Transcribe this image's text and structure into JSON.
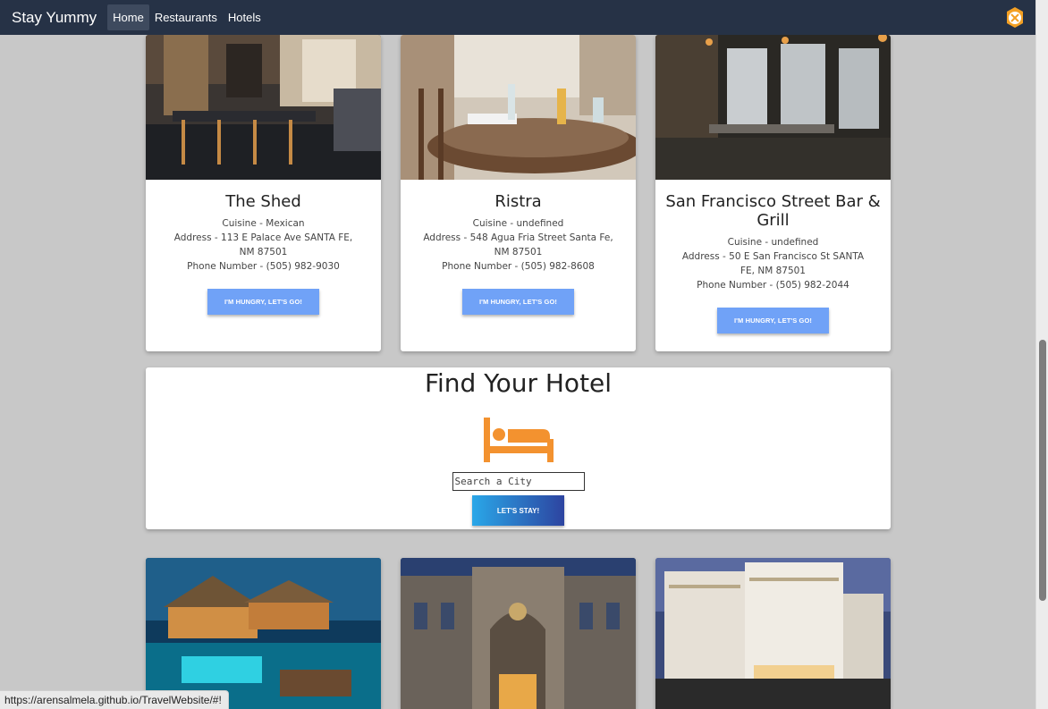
{
  "navbar": {
    "brand": "Stay Yummy",
    "links": [
      {
        "label": "Home",
        "active": true
      },
      {
        "label": "Restaurants",
        "active": false
      },
      {
        "label": "Hotels",
        "active": false
      }
    ]
  },
  "restaurants": [
    {
      "name": "The Shed",
      "cuisine": "Cuisine - Mexican",
      "address": "Address - 113 E Palace Ave SANTA FE, NM 87501",
      "phone": "Phone Number - (505) 982-9030",
      "button": "I'M HUNGRY, LET'S GO!"
    },
    {
      "name": "Ristra",
      "cuisine": "Cuisine - undefined",
      "address": "Address - 548 Agua Fria Street Santa Fe, NM 87501",
      "phone": "Phone Number - (505) 982-8608",
      "button": "I'M HUNGRY, LET'S GO!"
    },
    {
      "name": "San Francisco Street Bar & Grill",
      "cuisine": "Cuisine - undefined",
      "address": "Address - 50 E San Francisco St SANTA FE, NM 87501",
      "phone": "Phone Number - (505) 982-2044",
      "button": "I'M HUNGRY, LET'S GO!"
    }
  ],
  "hotel_search": {
    "heading": "Find Your Hotel",
    "placeholder": "Search a City",
    "button": "LET'S STAY!",
    "icon_color": "#f3922f"
  },
  "colors": {
    "navbar_bg": "#263246",
    "button_blue": "#70a2f7",
    "page_bg": "#c8c8c8"
  },
  "status_bar": {
    "url": "https://arensalmela.github.io/TravelWebsite/#!"
  }
}
